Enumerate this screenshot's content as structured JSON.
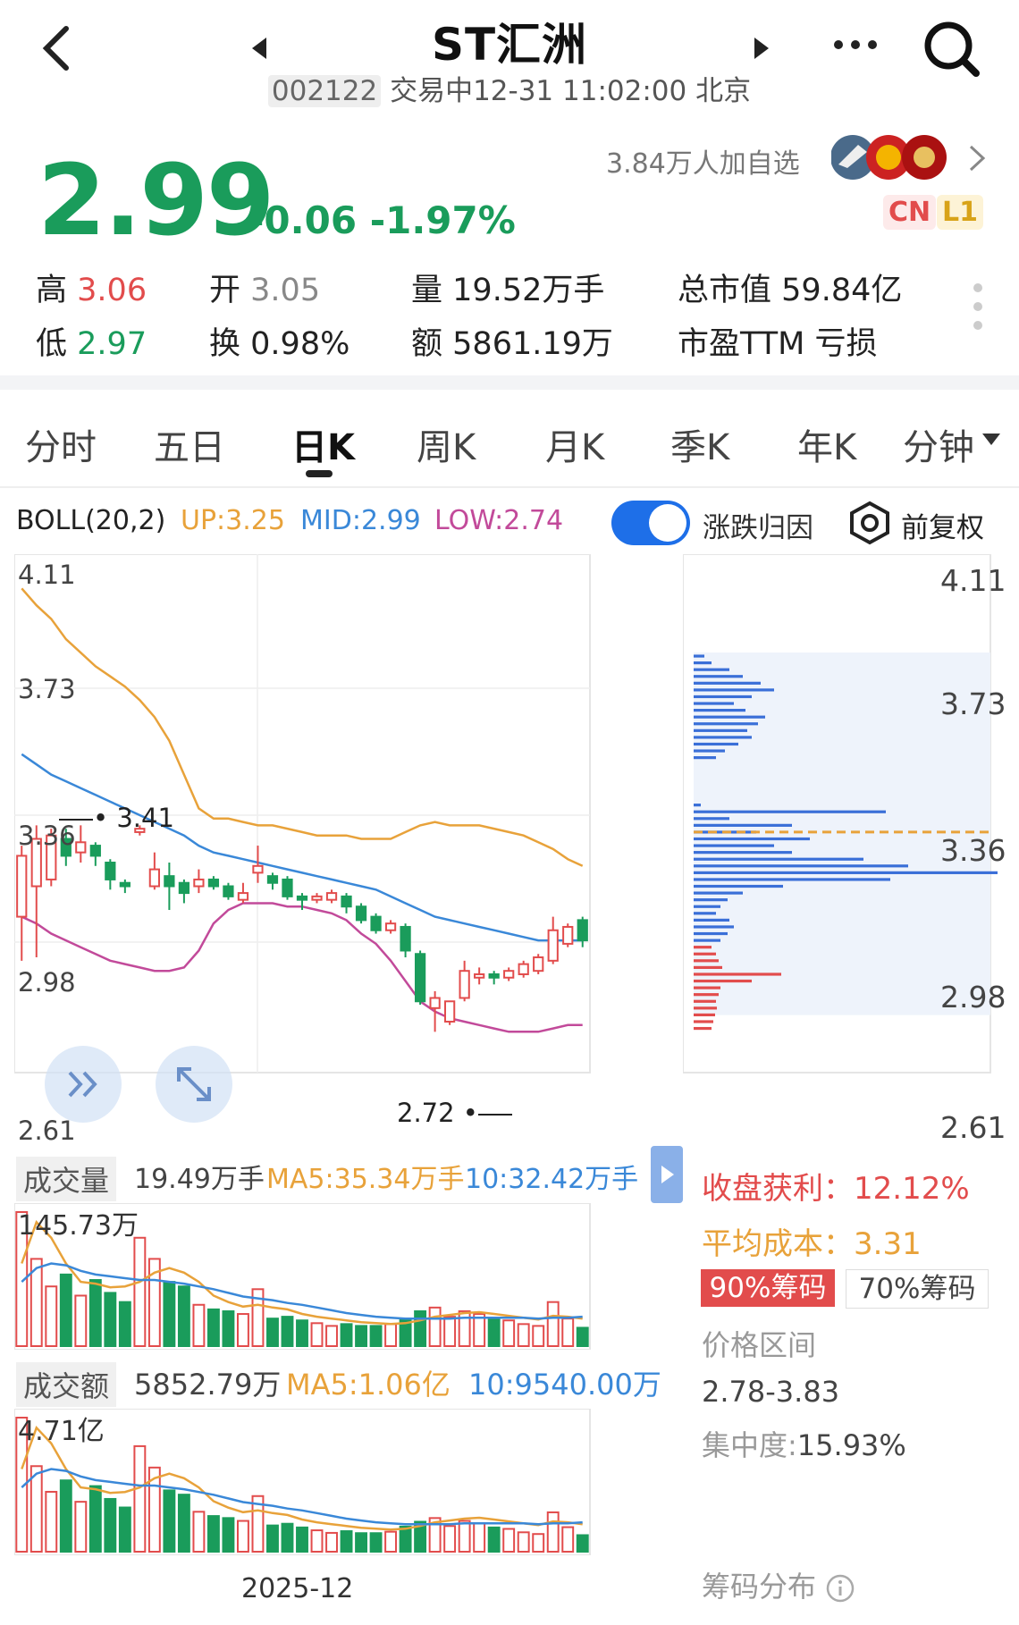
{
  "header": {
    "title": "ST汇洲",
    "code": "002122",
    "status": "交易中",
    "datetime": "12-31 11:02:00",
    "location": "北京"
  },
  "quote": {
    "price": "2.99",
    "change": "-0.06",
    "change_pct": "-1.97%",
    "followers": "3.84万人加自选",
    "badge_cn": "CN",
    "badge_l1": "L1",
    "stats": {
      "high_label": "高",
      "high": "3.06",
      "low_label": "低",
      "low": "2.97",
      "open_label": "开",
      "open": "3.05",
      "turnover_label": "换",
      "turnover": "0.98%",
      "volume_label": "量",
      "volume": "19.52万手",
      "amount_label": "额",
      "amount": "5861.19万",
      "mktcap_label": "总市值",
      "mktcap": "59.84亿",
      "pe_label": "市盈TTM",
      "pe": "亏损"
    }
  },
  "tabs": [
    "分时",
    "五日",
    "日K",
    "周K",
    "月K",
    "季K",
    "年K",
    "分钟"
  ],
  "active_tab": "日K",
  "boll": {
    "name": "BOLL(20,2)",
    "up": "UP:3.25",
    "mid": "MID:2.99",
    "low": "LOW:2.74",
    "toggle_label": "涨跌归因",
    "adjust_label": "前复权",
    "colors": {
      "up": "#e8a23a",
      "mid": "#3a88d8",
      "low": "#c24a9a"
    }
  },
  "kline": {
    "y_labels": [
      "4.11",
      "3.73",
      "3.36",
      "2.98",
      "2.61"
    ],
    "high_mark": "3.41",
    "low_mark": "2.72",
    "date_label": "2025-12"
  },
  "chip": {
    "y_labels": [
      "4.11",
      "3.73",
      "3.36",
      "2.98",
      "2.61"
    ],
    "profit_label": "收盘获利：",
    "profit": "12.12%",
    "avgcost_label": "平均成本：",
    "avgcost": "3.31",
    "tab90": "90%筹码",
    "tab70": "70%筹码",
    "range_label": "价格区间",
    "range": "2.78-3.83",
    "concentration_label": "集中度:",
    "concentration": "15.93%",
    "footer": "筹码分布"
  },
  "volume": {
    "label": "成交量",
    "value": "19.49万手",
    "ma5": "MA5:35.34万手",
    "ma10": "10:32.42万手",
    "max": "145.73万"
  },
  "amount": {
    "label": "成交额",
    "value": "5852.79万",
    "ma5": "MA5:1.06亿",
    "ma10": "10:9540.00万",
    "max": "4.71亿"
  },
  "chart_data": {
    "type": "candlestick",
    "title": "",
    "ylim": [
      2.61,
      4.11
    ],
    "candles": [
      {
        "o": 3.06,
        "c": 3.24,
        "h": 3.27,
        "l": 2.93
      },
      {
        "o": 3.15,
        "c": 3.29,
        "h": 3.33,
        "l": 2.94
      },
      {
        "o": 3.17,
        "c": 3.3,
        "h": 3.32,
        "l": 3.15
      },
      {
        "o": 3.29,
        "c": 3.24,
        "h": 3.32,
        "l": 3.21
      },
      {
        "o": 3.25,
        "c": 3.28,
        "h": 3.33,
        "l": 3.22
      },
      {
        "o": 3.27,
        "c": 3.24,
        "h": 3.28,
        "l": 3.21
      },
      {
        "o": 3.22,
        "c": 3.17,
        "h": 3.23,
        "l": 3.14
      },
      {
        "o": 3.16,
        "c": 3.15,
        "h": 3.17,
        "l": 3.13
      },
      {
        "o": 3.31,
        "c": 3.32,
        "h": 3.33,
        "l": 3.3
      },
      {
        "o": 3.15,
        "c": 3.2,
        "h": 3.25,
        "l": 3.14
      },
      {
        "o": 3.18,
        "c": 3.15,
        "h": 3.22,
        "l": 3.08
      },
      {
        "o": 3.16,
        "c": 3.13,
        "h": 3.17,
        "l": 3.1
      },
      {
        "o": 3.15,
        "c": 3.17,
        "h": 3.2,
        "l": 3.13
      },
      {
        "o": 3.17,
        "c": 3.15,
        "h": 3.18,
        "l": 3.14
      },
      {
        "o": 3.15,
        "c": 3.12,
        "h": 3.16,
        "l": 3.11
      },
      {
        "o": 3.11,
        "c": 3.13,
        "h": 3.16,
        "l": 3.1
      },
      {
        "o": 3.19,
        "c": 3.21,
        "h": 3.27,
        "l": 3.16
      },
      {
        "o": 3.18,
        "c": 3.16,
        "h": 3.19,
        "l": 3.14
      },
      {
        "o": 3.17,
        "c": 3.12,
        "h": 3.18,
        "l": 3.11
      },
      {
        "o": 3.12,
        "c": 3.11,
        "h": 3.13,
        "l": 3.08
      },
      {
        "o": 3.11,
        "c": 3.12,
        "h": 3.13,
        "l": 3.1
      },
      {
        "o": 3.11,
        "c": 3.13,
        "h": 3.14,
        "l": 3.1
      },
      {
        "o": 3.12,
        "c": 3.09,
        "h": 3.13,
        "l": 3.07
      },
      {
        "o": 3.09,
        "c": 3.05,
        "h": 3.1,
        "l": 3.04
      },
      {
        "o": 3.06,
        "c": 3.02,
        "h": 3.07,
        "l": 3.01
      },
      {
        "o": 3.02,
        "c": 3.04,
        "h": 3.05,
        "l": 3.01
      },
      {
        "o": 3.03,
        "c": 2.96,
        "h": 3.04,
        "l": 2.94
      },
      {
        "o": 2.95,
        "c": 2.81,
        "h": 2.96,
        "l": 2.8
      },
      {
        "o": 2.79,
        "c": 2.82,
        "h": 2.84,
        "l": 2.72
      },
      {
        "o": 2.75,
        "c": 2.81,
        "h": 2.81,
        "l": 2.74
      },
      {
        "o": 2.82,
        "c": 2.9,
        "h": 2.93,
        "l": 2.81
      },
      {
        "o": 2.88,
        "c": 2.89,
        "h": 2.91,
        "l": 2.86
      },
      {
        "o": 2.89,
        "c": 2.88,
        "h": 2.9,
        "l": 2.86
      },
      {
        "o": 2.88,
        "c": 2.9,
        "h": 2.91,
        "l": 2.87
      },
      {
        "o": 2.89,
        "c": 2.92,
        "h": 2.93,
        "l": 2.88
      },
      {
        "o": 2.9,
        "c": 2.94,
        "h": 2.95,
        "l": 2.89
      },
      {
        "o": 2.93,
        "c": 3.02,
        "h": 3.06,
        "l": 2.92
      },
      {
        "o": 2.98,
        "c": 3.03,
        "h": 3.04,
        "l": 2.97
      },
      {
        "o": 3.05,
        "c": 2.99,
        "h": 3.06,
        "l": 2.97
      }
    ],
    "boll_up": [
      4.03,
      3.98,
      3.94,
      3.88,
      3.84,
      3.8,
      3.77,
      3.74,
      3.7,
      3.65,
      3.58,
      3.48,
      3.38,
      3.35,
      3.35,
      3.34,
      3.33,
      3.33,
      3.32,
      3.31,
      3.3,
      3.3,
      3.3,
      3.29,
      3.29,
      3.29,
      3.31,
      3.33,
      3.34,
      3.33,
      3.33,
      3.33,
      3.32,
      3.31,
      3.3,
      3.28,
      3.26,
      3.23,
      3.21
    ],
    "boll_mid": [
      3.54,
      3.51,
      3.48,
      3.46,
      3.44,
      3.42,
      3.4,
      3.38,
      3.36,
      3.34,
      3.32,
      3.3,
      3.27,
      3.25,
      3.24,
      3.23,
      3.22,
      3.21,
      3.2,
      3.19,
      3.18,
      3.17,
      3.16,
      3.15,
      3.14,
      3.12,
      3.1,
      3.08,
      3.06,
      3.05,
      3.04,
      3.03,
      3.02,
      3.01,
      3.0,
      2.99,
      2.99,
      2.99,
      2.99
    ],
    "boll_low": [
      3.06,
      3.04,
      3.01,
      2.99,
      2.97,
      2.95,
      2.93,
      2.92,
      2.91,
      2.9,
      2.9,
      2.91,
      2.96,
      3.04,
      3.08,
      3.1,
      3.1,
      3.1,
      3.09,
      3.09,
      3.08,
      3.07,
      3.05,
      3.01,
      2.98,
      2.93,
      2.87,
      2.81,
      2.78,
      2.76,
      2.75,
      2.74,
      2.73,
      2.72,
      2.72,
      2.72,
      2.73,
      2.74,
      2.74
    ],
    "volume": [
      146,
      95,
      65,
      78,
      55,
      72,
      58,
      48,
      118,
      95,
      70,
      65,
      45,
      40,
      38,
      35,
      62,
      30,
      32,
      28,
      25,
      22,
      24,
      22,
      22,
      24,
      30,
      38,
      42,
      32,
      38,
      35,
      30,
      28,
      24,
      22,
      48,
      30,
      20
    ],
    "volume_ma5": [
      90,
      135,
      118,
      90,
      70,
      68,
      64,
      65,
      70,
      80,
      85,
      80,
      70,
      55,
      48,
      43,
      45,
      42,
      40,
      35,
      32,
      30,
      28,
      26,
      25,
      24,
      25,
      28,
      32,
      34,
      36,
      37,
      35,
      33,
      31,
      29,
      33,
      32,
      30
    ],
    "volume_ma10": [
      70,
      85,
      90,
      88,
      82,
      78,
      76,
      74,
      72,
      72,
      70,
      68,
      65,
      62,
      58,
      54,
      52,
      50,
      47,
      45,
      42,
      39,
      36,
      34,
      32,
      31,
      30,
      30,
      30,
      30,
      31,
      31,
      31,
      31,
      31,
      30,
      31,
      31,
      32
    ],
    "amount": [
      470,
      300,
      210,
      250,
      175,
      230,
      185,
      155,
      370,
      295,
      215,
      200,
      140,
      125,
      118,
      108,
      195,
      92,
      98,
      85,
      75,
      66,
      72,
      65,
      65,
      70,
      88,
      105,
      118,
      90,
      108,
      100,
      85,
      80,
      68,
      62,
      138,
      86,
      58
    ],
    "chip_bars": [
      {
        "p": 3.83,
        "w": 12,
        "c": "#3a6fd8"
      },
      {
        "p": 3.81,
        "w": 20,
        "c": "#3a6fd8"
      },
      {
        "p": 3.79,
        "w": 40,
        "c": "#3a6fd8"
      },
      {
        "p": 3.77,
        "w": 55,
        "c": "#3a6fd8"
      },
      {
        "p": 3.75,
        "w": 75,
        "c": "#3a6fd8"
      },
      {
        "p": 3.73,
        "w": 90,
        "c": "#3a6fd8"
      },
      {
        "p": 3.71,
        "w": 65,
        "c": "#3a6fd8"
      },
      {
        "p": 3.69,
        "w": 45,
        "c": "#3a6fd8"
      },
      {
        "p": 3.67,
        "w": 58,
        "c": "#3a6fd8"
      },
      {
        "p": 3.65,
        "w": 80,
        "c": "#3a6fd8"
      },
      {
        "p": 3.63,
        "w": 72,
        "c": "#3a6fd8"
      },
      {
        "p": 3.61,
        "w": 60,
        "c": "#3a6fd8"
      },
      {
        "p": 3.59,
        "w": 65,
        "c": "#3a6fd8"
      },
      {
        "p": 3.57,
        "w": 50,
        "c": "#3a6fd8"
      },
      {
        "p": 3.55,
        "w": 35,
        "c": "#3a6fd8"
      },
      {
        "p": 3.53,
        "w": 25,
        "c": "#3a6fd8"
      },
      {
        "p": 3.39,
        "w": 8,
        "c": "#3a6fd8"
      },
      {
        "p": 3.37,
        "w": 215,
        "c": "#3a6fd8"
      },
      {
        "p": 3.35,
        "w": 40,
        "c": "#3a6fd8"
      },
      {
        "p": 3.33,
        "w": 110,
        "c": "#3a6fd8"
      },
      {
        "p": 3.31,
        "w": 70,
        "c": "#3a6fd8"
      },
      {
        "p": 3.29,
        "w": 130,
        "c": "#3a6fd8"
      },
      {
        "p": 3.27,
        "w": 90,
        "c": "#3a6fd8"
      },
      {
        "p": 3.25,
        "w": 110,
        "c": "#3a6fd8"
      },
      {
        "p": 3.23,
        "w": 190,
        "c": "#3a6fd8"
      },
      {
        "p": 3.21,
        "w": 240,
        "c": "#3a6fd8"
      },
      {
        "p": 3.19,
        "w": 340,
        "c": "#3a6fd8"
      },
      {
        "p": 3.17,
        "w": 220,
        "c": "#3a6fd8"
      },
      {
        "p": 3.15,
        "w": 100,
        "c": "#3a6fd8"
      },
      {
        "p": 3.13,
        "w": 55,
        "c": "#3a6fd8"
      },
      {
        "p": 3.11,
        "w": 38,
        "c": "#3a6fd8"
      },
      {
        "p": 3.09,
        "w": 30,
        "c": "#3a6fd8"
      },
      {
        "p": 3.07,
        "w": 25,
        "c": "#3a6fd8"
      },
      {
        "p": 3.05,
        "w": 40,
        "c": "#3a6fd8"
      },
      {
        "p": 3.03,
        "w": 45,
        "c": "#3a6fd8"
      },
      {
        "p": 3.01,
        "w": 38,
        "c": "#3a6fd8"
      },
      {
        "p": 2.99,
        "w": 30,
        "c": "#3a6fd8"
      },
      {
        "p": 2.97,
        "w": 20,
        "c": "#e24c4c"
      },
      {
        "p": 2.95,
        "w": 25,
        "c": "#e24c4c"
      },
      {
        "p": 2.93,
        "w": 28,
        "c": "#e24c4c"
      },
      {
        "p": 2.91,
        "w": 32,
        "c": "#e24c4c"
      },
      {
        "p": 2.89,
        "w": 98,
        "c": "#e24c4c"
      },
      {
        "p": 2.87,
        "w": 65,
        "c": "#e24c4c"
      },
      {
        "p": 2.85,
        "w": 30,
        "c": "#e24c4c"
      },
      {
        "p": 2.83,
        "w": 28,
        "c": "#e24c4c"
      },
      {
        "p": 2.81,
        "w": 25,
        "c": "#e24c4c"
      },
      {
        "p": 2.79,
        "w": 26,
        "c": "#e24c4c"
      },
      {
        "p": 2.77,
        "w": 24,
        "c": "#e24c4c"
      },
      {
        "p": 2.75,
        "w": 22,
        "c": "#e24c4c"
      },
      {
        "p": 2.73,
        "w": 20,
        "c": "#e24c4c"
      }
    ],
    "avg_cost": 3.31
  }
}
